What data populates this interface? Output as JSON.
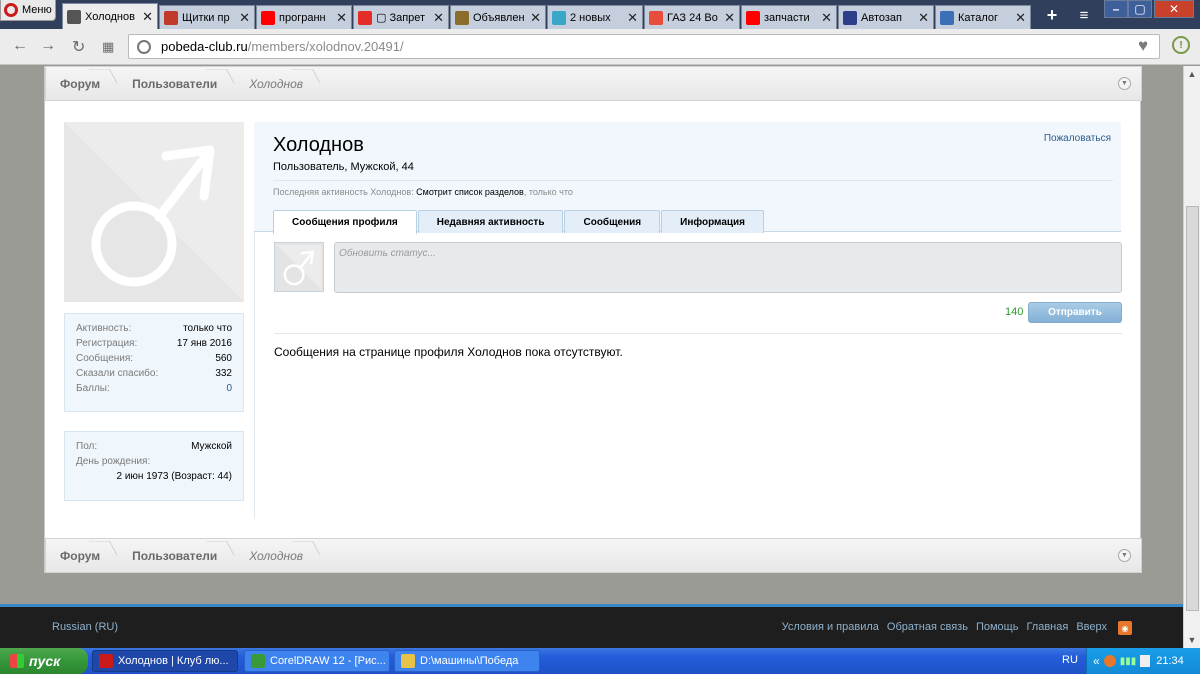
{
  "browser": {
    "menu_label": "Меню",
    "tabs": [
      {
        "title": "Холоднов",
        "icon": "site-favicon",
        "color": "#555555",
        "active": true
      },
      {
        "title": "Щитки пр",
        "icon": "site-favicon",
        "color": "#c0392b"
      },
      {
        "title": "програнн",
        "icon": "yandex-icon",
        "color": "#ff0000"
      },
      {
        "title": "▢ Запрет",
        "icon": "youtube-icon",
        "color": "#e52d27"
      },
      {
        "title": "Объявлен",
        "icon": "car-icon",
        "color": "#8a6d2a"
      },
      {
        "title": "2 новых",
        "icon": "ok-icon",
        "color": "#3aa6c8"
      },
      {
        "title": "ГАЗ 24 Во",
        "icon": "dots-icon",
        "color": "#e74c3c"
      },
      {
        "title": "запчасти",
        "icon": "yandex-icon",
        "color": "#ff0000"
      },
      {
        "title": "Автозап",
        "icon": "eye-icon",
        "color": "#2c3e8a"
      },
      {
        "title": "Каталог",
        "icon": "search-icon",
        "color": "#3b6fb6"
      }
    ],
    "url_host": "pobeda-club.ru",
    "url_path": "/members/xolodnov.20491/"
  },
  "breadcrumb": {
    "items": [
      "Форум",
      "Пользователи",
      "Холоднов"
    ]
  },
  "sidebar": {
    "stats": [
      {
        "label": "Активность:",
        "value": "только что"
      },
      {
        "label": "Регистрация:",
        "value": "17 янв 2016"
      },
      {
        "label": "Сообщения:",
        "value": "560"
      },
      {
        "label": "Сказали спасибо:",
        "value": "332"
      },
      {
        "label": "Баллы:",
        "value": "0"
      }
    ],
    "personal": {
      "gender_label": "Пол:",
      "gender_value": "Мужской",
      "birthday_label": "День рождения:",
      "birthday_value": "2 июн 1973 (Возраст: 44)"
    }
  },
  "profile": {
    "name": "Холоднов",
    "meta": "Пользователь, Мужской, 44",
    "report": "Пожаловаться",
    "last_activity_prefix": "Последняя активность Холоднов:",
    "last_activity_action": "Смотрит список разделов",
    "last_activity_time": ", только что",
    "tabs": [
      "Сообщения профиля",
      "Недавняя активность",
      "Сообщения",
      "Информация"
    ],
    "status_placeholder": "Обновить статус...",
    "char_counter": "140",
    "send_label": "Отправить",
    "empty_message": "Сообщения на странице профиля Холоднов пока отсутствуют."
  },
  "footer": {
    "language": "Russian (RU)",
    "links": [
      "Условия и правила",
      "Обратная связь",
      "Помощь",
      "Главная",
      "Вверх"
    ]
  },
  "taskbar": {
    "start_label": "пуск",
    "tasks": [
      {
        "title": "Холоднов | Клуб лю...",
        "icon": "opera-icon",
        "active": true
      },
      {
        "title": "CorelDRAW 12 - [Рис...",
        "icon": "coreldraw-icon"
      },
      {
        "title": "D:\\машины\\Победа",
        "icon": "folder-icon"
      }
    ],
    "lang": "RU",
    "clock": "21:34"
  }
}
